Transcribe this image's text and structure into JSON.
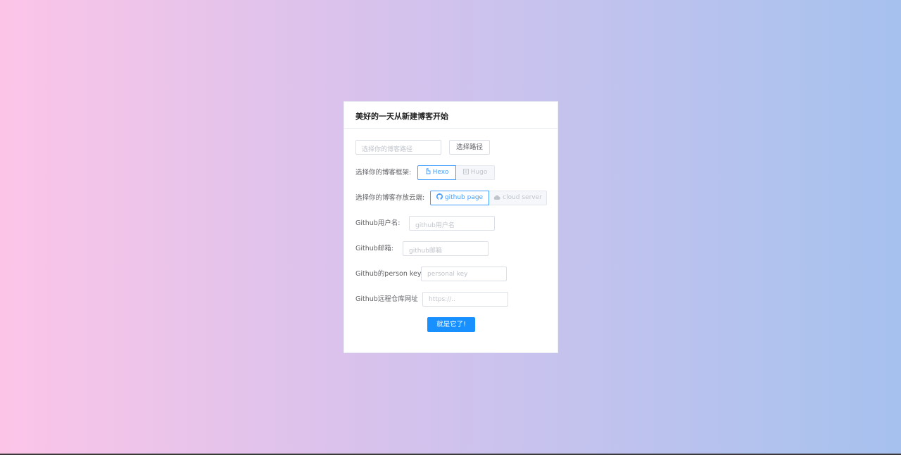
{
  "card": {
    "title": "美好的一天从新建博客开始"
  },
  "path_row": {
    "input_placeholder": "选择你的博客路径",
    "choose_button": "选择路径"
  },
  "framework_row": {
    "label": "选择你的博客框架:",
    "options": [
      {
        "label": "Hexo",
        "icon": "hexo-icon",
        "state": "selected"
      },
      {
        "label": "Hugo",
        "icon": "hugo-icon",
        "state": "disabled"
      }
    ]
  },
  "host_row": {
    "label": "选择你的博客存放云端:",
    "options": [
      {
        "label": "github page",
        "icon": "github-icon",
        "state": "selected"
      },
      {
        "label": "cloud server",
        "icon": "cloud-icon",
        "state": "disabled"
      }
    ]
  },
  "fields": [
    {
      "label": "Github用户名:",
      "placeholder": "github用户名"
    },
    {
      "label": "Github邮箱:",
      "placeholder": "github邮箱"
    },
    {
      "label": "Github的person key",
      "placeholder": "personal key"
    },
    {
      "label": "Github远程仓库网址",
      "placeholder": "https://.."
    }
  ],
  "submit_button": "就是它了!",
  "colors": {
    "primary": "#1890ff",
    "selected_border": "#409eff",
    "gradient_left": "#fcc5e8",
    "gradient_right": "#a6c1ee"
  }
}
